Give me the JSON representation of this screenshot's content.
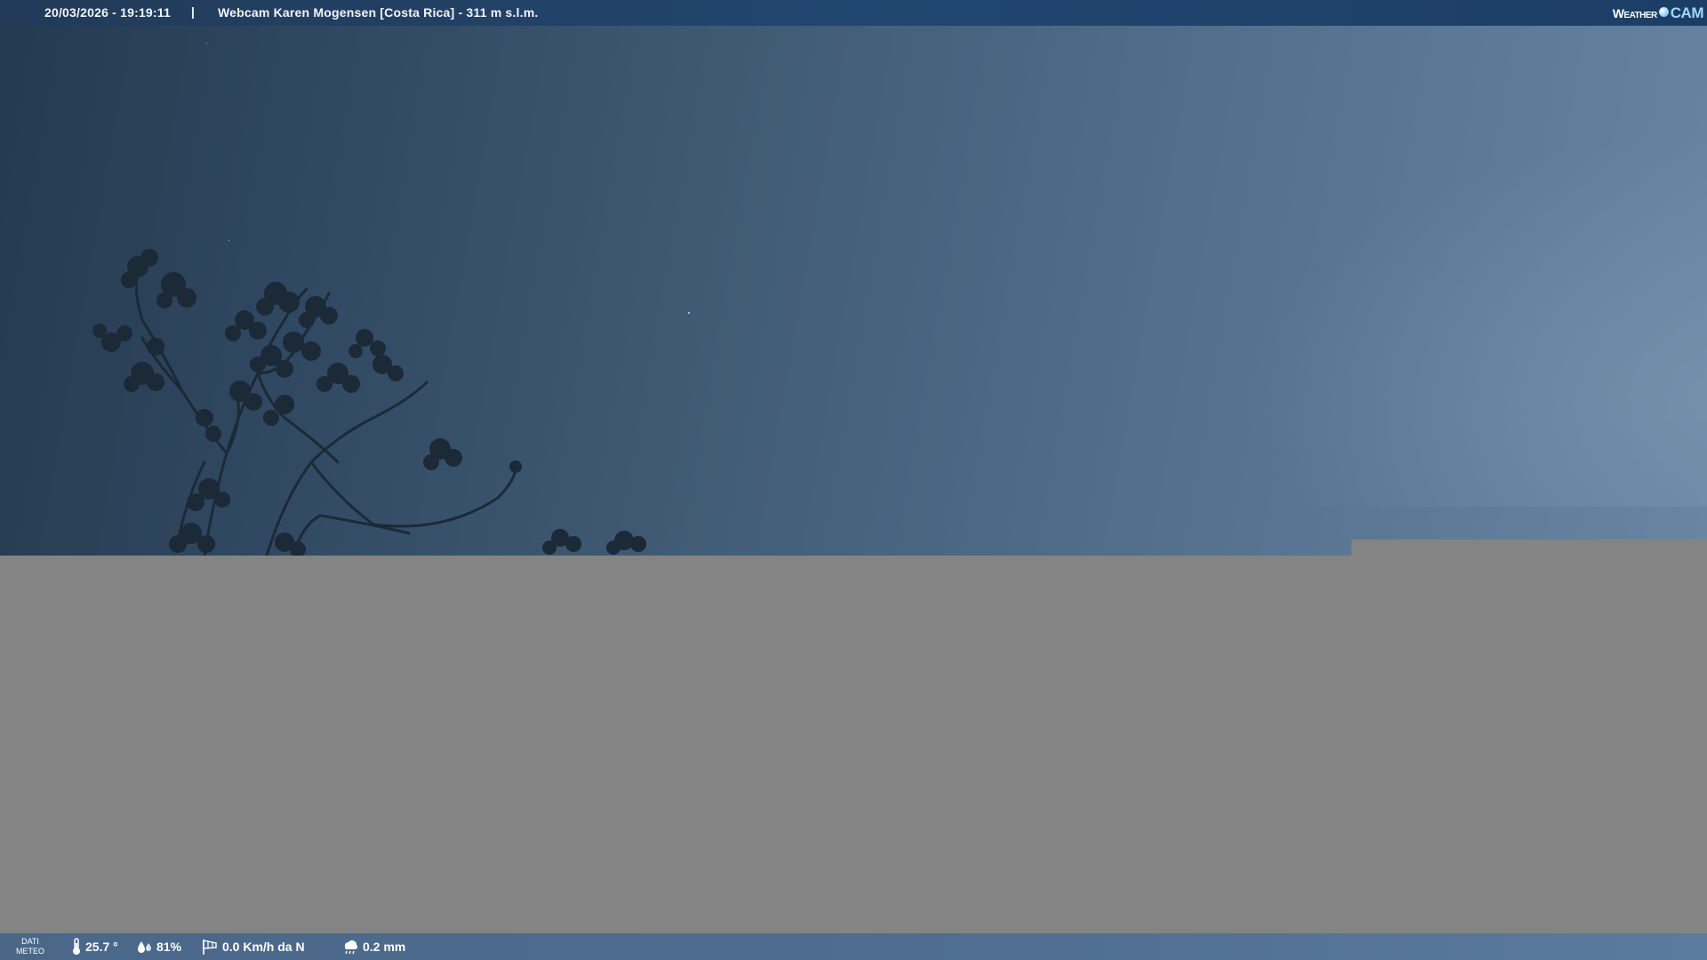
{
  "header": {
    "timestamp": "20/03/2026 - 19:19:11",
    "separator": "|",
    "title": "Webcam Karen Mogensen [Costa Rica]  - 311 m s.l.m.",
    "brand_weather": "Weather",
    "brand_cam": "CAM"
  },
  "footer": {
    "section_label_line1": "DATI",
    "section_label_line2": "METEO",
    "temperature": "25.7 °",
    "humidity": "81%",
    "wind": "0.0 Km/h da N",
    "rain": "0.2 mm"
  },
  "icons": {
    "temperature": "thermometer-icon",
    "humidity": "humidity-drops-icon",
    "wind": "windsock-icon",
    "rain": "rain-cloud-icon"
  },
  "colors": {
    "top_bar": "#21466f",
    "bottom_bar": "#4f6e92",
    "mask_grey": "#848484",
    "sky_dark": "#243a4e",
    "sky_light": "#6886a2",
    "brand_accent": "#9fd6ff"
  }
}
